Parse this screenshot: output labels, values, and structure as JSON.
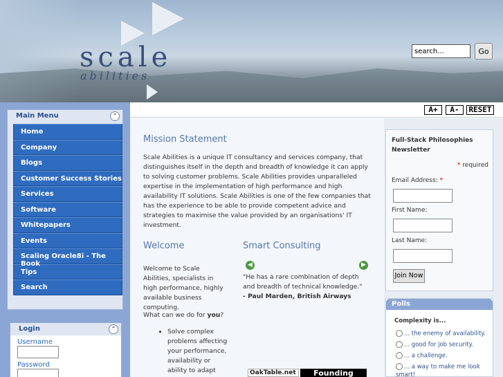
{
  "header": {
    "logo_main": "scale",
    "logo_sub": "abilities",
    "search_placeholder": "search...",
    "search_button": "Go"
  },
  "main_menu": {
    "title": "Main Menu",
    "items": [
      "Home",
      "Company",
      "Blogs",
      "Customer Success Stories",
      "Services",
      "Software",
      "Whitepapers",
      "Events",
      "Scaling Oracle8i - The Book",
      "Tips",
      "Search"
    ]
  },
  "login": {
    "title": "Login",
    "username_label": "Username",
    "password_label": "Password"
  },
  "toolbar": {
    "increase": "A+",
    "decrease": "A-",
    "reset": "RESET"
  },
  "mission": {
    "title": "Mission Statement",
    "body": "Scale Abilities is a unique IT consultancy and services company, that distinguishes itself in the depth and breadth of knowledge it can apply to solving customer problems. Scale Abilities provides unparalleled expertise in the implementation of high performance and high availability IT solutions. Scale Abilities is one of the few companies that has the experience to be able to provide competent advice and strategies to maximise the value provided by an organisations' IT investment."
  },
  "welcome": {
    "title": "Welcome",
    "body": "Welcome to Scale Abilities, specialists in high performance, highly available business computing.",
    "question_prefix": "What can we do for ",
    "question_bold": "you",
    "question_suffix": "?",
    "bullet": "Solve complex problems affecting your performance, availability or ability to adapt and grow"
  },
  "smart": {
    "title": "Smart Consulting",
    "quote": "\"He has a rare combination of depth and breadth of technical knowledge.\"",
    "author": "- Paul Marden, British Airways"
  },
  "badges": {
    "oaktable": "OakTable.net",
    "founding": "Founding"
  },
  "newsletter": {
    "title": "Full-Stack Philosophies Newsletter",
    "required": "required",
    "email_label": "Email Address:",
    "first_name_label": "First Name:",
    "last_name_label": "Last Name:",
    "join_button": "Join Now"
  },
  "polls": {
    "title": "Polls",
    "question": "Complexity is...",
    "options": [
      "... the enemy of availability.",
      "... good for job security.",
      "... a challenge.",
      "... a way to make me look smart!"
    ]
  }
}
